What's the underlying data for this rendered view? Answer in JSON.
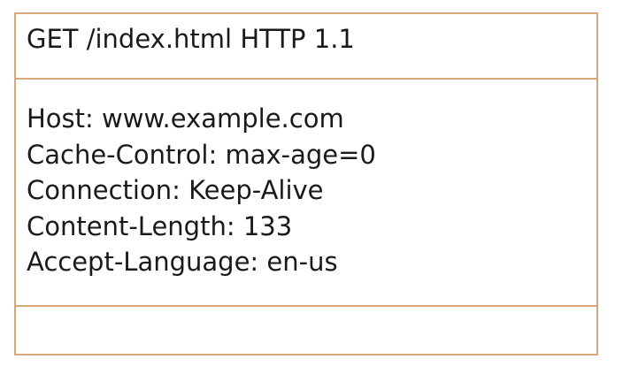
{
  "request": {
    "request_line": "GET /index.html HTTP 1.1",
    "headers": [
      "Host: www.example.com",
      "Cache-Control: max-age=0",
      "Connection: Keep-Alive",
      "Content-Length: 133",
      "Accept-Language: en-us"
    ],
    "body": ""
  },
  "colors": {
    "border": "#d9a57a",
    "text": "#1a1a1a",
    "background": "#ffffff"
  }
}
